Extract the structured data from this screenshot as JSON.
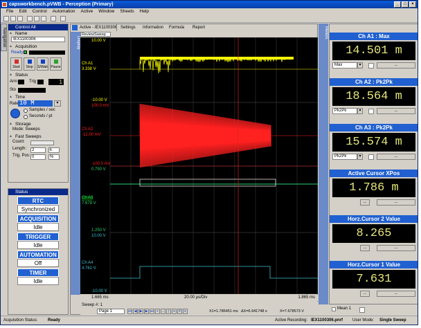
{
  "window": {
    "title": "capsworkbench.pVWB - Perception (Primary)"
  },
  "menu": [
    "File",
    "Edit",
    "Control",
    "Automation",
    "Active",
    "Window",
    "Sheets",
    "Help"
  ],
  "left_tab": "Navigation",
  "control": {
    "title": "Control All",
    "name_label": "Name",
    "name_value": "IEX1100306",
    "acquisition_label": "Acquisition",
    "acq_state": "Ready",
    "buttons": [
      "Start",
      "Stop",
      "S/Wait",
      "Pause"
    ],
    "status_label": "Status",
    "arm": "Arm",
    "trig": "Trig",
    "trig_count": "1",
    "sto": "Sto",
    "time_label": "Time",
    "rate_label": "Rate",
    "rate_value": "10 M",
    "samples_label": "Samples / sec",
    "seconds_label": "Seconds / pt",
    "storage_label": "Storage",
    "mode_label": "Mode:",
    "mode_value": "Sweeps",
    "fast_sweeps": "Fast Sweeps",
    "count_label": "Count:",
    "length_label": "Length:",
    "length_value": "2",
    "length_unit": "k",
    "trigpos_label": "Trig. Pos:",
    "trigpos_value": "0",
    "trigpos_unit": "%"
  },
  "status_panel": {
    "title": "Status",
    "items": [
      {
        "title": "RTC",
        "value": "Synchronized"
      },
      {
        "title": "ACQUISITION",
        "value": "Idle"
      },
      {
        "title": "TRIGGER",
        "value": "Idle"
      },
      {
        "title": "AUTOMATION",
        "value": "Off"
      },
      {
        "title": "TIMER",
        "value": "Idle"
      }
    ]
  },
  "active": {
    "title": "Active - IEX1100306",
    "tabs": [
      "Settings",
      "Information",
      "Formula",
      "Report"
    ],
    "display_tab": "Display",
    "subtab": "ReviewSweep",
    "channels": [
      {
        "name": "Ch A1",
        "value": "3.338  V",
        "top": "10.00  V",
        "bottom": "-10.00  V",
        "color": "#ffff00"
      },
      {
        "name": "Ch A2",
        "value": "-12.00 mV",
        "top": "100.0 mV",
        "bottom": "-100.0 mV",
        "color": "#ff2020"
      },
      {
        "name": "Ch A3",
        "value": "7.679  V",
        "top": "0.750  V",
        "bottom": "1.250  V",
        "color": "#30d070"
      },
      {
        "name": "Ch A4",
        "value": "4.761  V",
        "top": "10.00  V",
        "bottom": "-10.00  V",
        "color": "#40c0d0"
      }
    ],
    "x_left": "1.665 ms",
    "x_div": "20.00 µs/Div",
    "x_right": "1.865 ms",
    "sweep": "Sweep #: 1",
    "page": "Page 1",
    "x1": "X1=1.786451 ms",
    "dx": "ΔX=6.941748 s",
    "x2": "X=7.678573 V"
  },
  "right_tab": "Meters",
  "meters": [
    {
      "title": "Ch A1 : Max",
      "value": "14.501 m",
      "select": "Max"
    },
    {
      "title": "Ch A2 : Pk2Pk",
      "value": "18.564 m",
      "select": "Pk2Pk"
    },
    {
      "title": "Ch A3 : Pk2Pk",
      "value": "15.574 m",
      "select": "Pk2Pk"
    },
    {
      "title": "Active Cursor XPos",
      "value": "1.786 m",
      "select": ""
    },
    {
      "title": "Horz.Cursor 2 Value",
      "value": "8.265",
      "select": ""
    },
    {
      "title": "Horz.Cursor 1 Value",
      "value": "7.631",
      "select": ""
    }
  ],
  "meter_footer": "Mean 1",
  "statusbar": {
    "acq_label": "Acquisition Status:",
    "acq_value": "Ready",
    "rec_label": "Active Recording:",
    "rec_value": "IEX1100306.pnrf",
    "user_label": "User Mode:",
    "user_value": "Single Sweep"
  }
}
